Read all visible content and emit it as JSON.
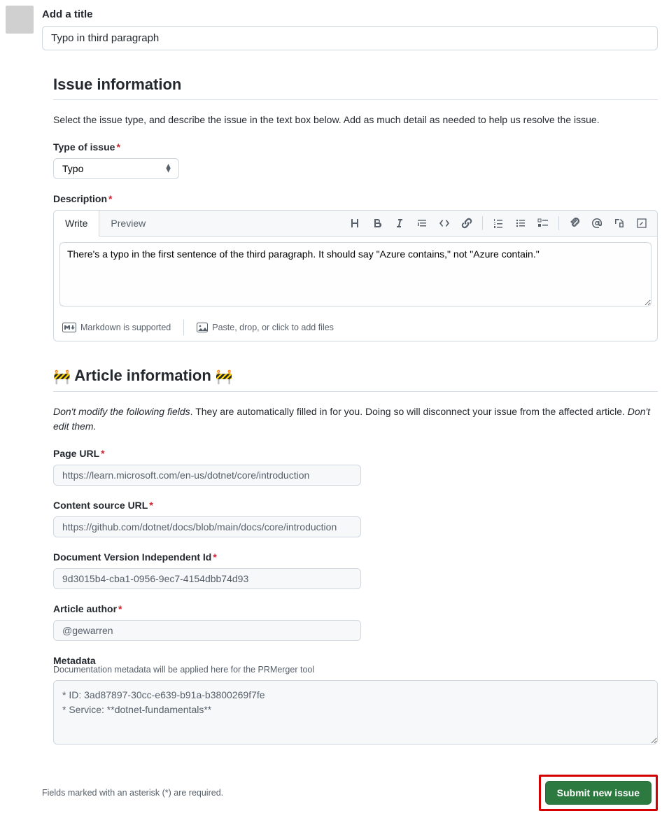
{
  "title_section": {
    "label": "Add a title",
    "value": "Typo in third paragraph"
  },
  "issue_info": {
    "heading": "Issue information",
    "description": "Select the issue type, and describe the issue in the text box below. Add as much detail as needed to help us resolve the issue.",
    "type_label": "Type of issue",
    "type_value": "Typo",
    "desc_label": "Description",
    "tabs": {
      "write": "Write",
      "preview": "Preview"
    },
    "body_value": "There's a typo in the first sentence of the third paragraph. It should say \"Azure contains,\" not \"Azure contain.\"",
    "markdown_note": "Markdown is supported",
    "attach_note": "Paste, drop, or click to add files"
  },
  "article_info": {
    "heading": "Article information",
    "desc_prefix_italic": "Don't modify the following fields",
    "desc_rest": ". They are automatically filled in for you. Doing so will disconnect your issue from the affected article. ",
    "desc_suffix_italic": "Don't edit them.",
    "page_url_label": "Page URL",
    "page_url_value": "https://learn.microsoft.com/en-us/dotnet/core/introduction",
    "source_url_label": "Content source URL",
    "source_url_value": "https://github.com/dotnet/docs/blob/main/docs/core/introduction",
    "doc_id_label": "Document Version Independent Id",
    "doc_id_value": "9d3015b4-cba1-0956-9ec7-4154dbb74d93",
    "author_label": "Article author",
    "author_value": "@gewarren",
    "metadata_label": "Metadata",
    "metadata_helper": "Documentation metadata will be applied here for the PRMerger tool",
    "metadata_value": "* ID: 3ad87897-30cc-e639-b91a-b3800269f7fe\n* Service: **dotnet-fundamentals**"
  },
  "footer": {
    "note": "Fields marked with an asterisk (*) are required.",
    "submit_label": "Submit new issue"
  }
}
